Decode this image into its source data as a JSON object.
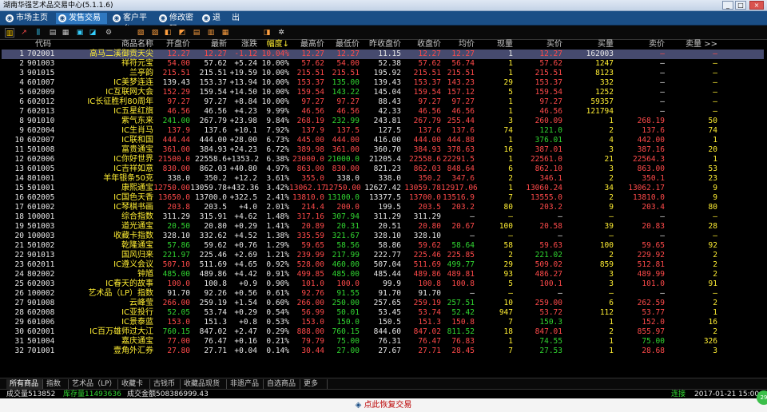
{
  "window": {
    "title": "湖南华强艺术品交易中心(5.1.1.6)",
    "min_label": "_",
    "max_label": "□",
    "close_label": "×"
  },
  "menu": [
    {
      "label": "市场主页",
      "active": false
    },
    {
      "label": "发售交易",
      "active": true
    },
    {
      "label": "客户平台",
      "active": false
    },
    {
      "label": "修改密码",
      "active": false
    },
    {
      "label": "退",
      "active": false
    },
    {
      "label": "出",
      "active": false
    }
  ],
  "toolbar_icons": [
    "bar-chart-icon",
    "line-chart-icon",
    "candle-icon",
    "list-icon",
    "calendar-icon",
    "grid-icon",
    "refresh-icon",
    "gear-icon",
    "book-icon",
    "sort-icon",
    "info-icon",
    "link-icon",
    "excel-icon",
    "print-icon",
    "cell-icon",
    "bell-icon",
    "settings-icon"
  ],
  "columns": [
    "代码",
    "商品名称",
    "开盘价",
    "最新",
    "涨跌",
    "幅度↓",
    "最高价",
    "最低价",
    "昨收盘价",
    "收盘价",
    "均价",
    "现量",
    "买价",
    "买量",
    "卖价",
    "卖量 >>"
  ],
  "rows": [
    [
      "1",
      "702001",
      "高马二溪御贡天尖",
      "12.27",
      "12.27",
      "-1.12",
      "10.04%",
      "12.27",
      "12.27",
      "11.15",
      "12.27",
      "12.27",
      "1",
      "12.27",
      "162003",
      "—",
      "—"
    ],
    [
      "2",
      "901003",
      "祥符元宝",
      "54.00",
      "57.62",
      "+5.24",
      "10.00%",
      "57.62",
      "54.00",
      "52.38",
      "57.62",
      "56.74",
      "1",
      "57.62",
      "1247",
      "—",
      "—"
    ],
    [
      "3",
      "901015",
      "兰亭韵",
      "215.51",
      "215.51",
      "+19.59",
      "10.00%",
      "215.51",
      "215.51",
      "195.92",
      "215.51",
      "215.51",
      "1",
      "215.51",
      "8123",
      "—",
      "—"
    ],
    [
      "4",
      "601007",
      "IC美梦连连",
      "139.43",
      "153.37",
      "+13.94",
      "10.00%",
      "153.37",
      "135.00",
      "139.43",
      "153.37",
      "143.23",
      "29",
      "153.37",
      "332",
      "—",
      "—"
    ],
    [
      "5",
      "602009",
      "IC互联网大会",
      "152.29",
      "159.54",
      "+14.50",
      "10.00%",
      "159.54",
      "143.22",
      "145.04",
      "159.54",
      "157.12",
      "5",
      "159.54",
      "1252",
      "—",
      "—"
    ],
    [
      "6",
      "602012",
      "IC长征胜利80周年",
      "97.27",
      "97.27",
      "+8.84",
      "10.00%",
      "97.27",
      "97.27",
      "88.43",
      "97.27",
      "97.27",
      "1",
      "97.27",
      "59357",
      "—",
      "—"
    ],
    [
      "7",
      "602013",
      "IC五星红旗",
      "46.56",
      "46.56",
      "+4.23",
      "9.99%",
      "46.56",
      "46.56",
      "42.33",
      "46.56",
      "46.56",
      "1",
      "46.56",
      "121794",
      "—",
      "—"
    ],
    [
      "8",
      "901010",
      "紫气东来",
      "241.00",
      "267.79",
      "+23.98",
      "9.84%",
      "268.19",
      "232.99",
      "243.81",
      "267.79",
      "255.44",
      "3",
      "260.09",
      "1",
      "268.19",
      "50"
    ],
    [
      "9",
      "602004",
      "IC生肖马",
      "137.9",
      "137.6",
      "+10.1",
      "7.92%",
      "137.9",
      "137.5",
      "127.5",
      "137.6",
      "137.6",
      "74",
      "121.0",
      "2",
      "137.6",
      "74"
    ],
    [
      "10",
      "602007",
      "IC联和国",
      "444.44",
      "444.00",
      "+28.00",
      "6.73%",
      "445.00",
      "444.00",
      "416.00",
      "444.00",
      "444.88",
      "1",
      "376.01",
      "4",
      "442.00",
      "1"
    ],
    [
      "11",
      "501008",
      "富贵通宝",
      "361.00",
      "384.93",
      "+24.23",
      "6.72%",
      "389.98",
      "361.00",
      "360.70",
      "384.93",
      "378.63",
      "16",
      "387.01",
      "3",
      "387.16",
      "20"
    ],
    [
      "12",
      "602006",
      "IC你好世界",
      "21500.0",
      "22558.6",
      "+1353.2",
      "6.38%",
      "23000.0",
      "21000.0",
      "21205.4",
      "22558.6",
      "22291.5",
      "1",
      "22561.0",
      "21",
      "22564.3",
      "1"
    ],
    [
      "13",
      "601005",
      "IC吉祥如意",
      "830.00",
      "862.03",
      "+40.80",
      "4.97%",
      "863.00",
      "830.00",
      "821.23",
      "862.03",
      "848.64",
      "6",
      "862.10",
      "3",
      "863.00",
      "53"
    ],
    [
      "14",
      "801001",
      "羊年银条50克",
      "338.0",
      "350.2",
      "+12.2",
      "3.61%",
      "355.0",
      "338.0",
      "338.0",
      "350.2",
      "347.6",
      "2",
      "346.1",
      "2",
      "350.1",
      "23"
    ],
    [
      "15",
      "501001",
      "康熙通宝",
      "12750.00",
      "13059.78",
      "+432.36",
      "3.42%",
      "13062.17",
      "12750.00",
      "12627.42",
      "13059.78",
      "12917.06",
      "1",
      "13060.24",
      "34",
      "13062.17",
      "9"
    ],
    [
      "16",
      "602005",
      "IC国色天香",
      "13650.0",
      "13700.0",
      "+322.5",
      "2.41%",
      "13810.0",
      "13100.0",
      "13377.5",
      "13700.0",
      "13516.9",
      "7",
      "13555.0",
      "2",
      "13810.0",
      "9"
    ],
    [
      "17",
      "601002",
      "IC琴棋书画",
      "203.8",
      "203.5",
      "+4.0",
      "2.01%",
      "214.4",
      "200.0",
      "199.5",
      "203.5",
      "203.2",
      "80",
      "203.2",
      "9",
      "203.4",
      "80"
    ],
    [
      "18",
      "100001",
      "综合指数",
      "311.29",
      "315.91",
      "+4.62",
      "1.48%",
      "317.16",
      "307.94",
      "311.29",
      "311.29",
      "—",
      "—",
      "—",
      "—",
      "—",
      "—"
    ],
    [
      "19",
      "501003",
      "道光通宝",
      "20.50",
      "20.80",
      "+0.29",
      "1.41%",
      "20.89",
      "20.31",
      "20.51",
      "20.80",
      "20.67",
      "100",
      "20.58",
      "39",
      "20.83",
      "28"
    ],
    [
      "20",
      "100003",
      "收藏卡指数",
      "328.10",
      "332.62",
      "+4.52",
      "1.38%",
      "335.59",
      "321.67",
      "328.10",
      "328.10",
      "—",
      "—",
      "—",
      "—",
      "—",
      "—"
    ],
    [
      "21",
      "501002",
      "乾隆通宝",
      "57.86",
      "59.62",
      "+0.76",
      "1.29%",
      "59.65",
      "58.56",
      "58.86",
      "59.62",
      "58.64",
      "58",
      "59.63",
      "100",
      "59.65",
      "92"
    ],
    [
      "22",
      "901013",
      "国风归来",
      "221.97",
      "225.46",
      "+2.69",
      "1.21%",
      "239.99",
      "217.99",
      "222.77",
      "225.46",
      "225.85",
      "2",
      "221.02",
      "2",
      "229.92",
      "2"
    ],
    [
      "23",
      "602011",
      "IC遵义会议",
      "507.10",
      "511.69",
      "+4.65",
      "0.92%",
      "528.00",
      "460.00",
      "507.04",
      "511.69",
      "499.77",
      "29",
      "509.02",
      "859",
      "512.81",
      "2"
    ],
    [
      "24",
      "802002",
      "钟馗",
      "485.00",
      "489.86",
      "+4.42",
      "0.91%",
      "499.85",
      "485.00",
      "485.44",
      "489.86",
      "489.81",
      "93",
      "486.27",
      "3",
      "489.99",
      "2"
    ],
    [
      "25",
      "602003",
      "IC春天的故事",
      "100.0",
      "100.8",
      "+0.9",
      "0.90%",
      "101.0",
      "100.0",
      "99.9",
      "100.8",
      "100.8",
      "5",
      "100.1",
      "3",
      "101.0",
      "91"
    ],
    [
      "26",
      "100002",
      "艺术品（LP）指数",
      "91.70",
      "92.26",
      "+0.56",
      "0.61%",
      "92.76",
      "91.55",
      "91.70",
      "91.70",
      "—",
      "—",
      "—",
      "—",
      "—",
      "—"
    ],
    [
      "27",
      "901008",
      "云峰莹",
      "266.00",
      "259.19",
      "+1.54",
      "0.60%",
      "266.00",
      "250.00",
      "257.65",
      "259.19",
      "257.51",
      "10",
      "259.00",
      "6",
      "262.59",
      "2"
    ],
    [
      "28",
      "602008",
      "IC亚投行",
      "52.05",
      "53.74",
      "+0.29",
      "0.54%",
      "56.99",
      "50.01",
      "53.45",
      "53.74",
      "52.42",
      "947",
      "53.72",
      "112",
      "53.77",
      "1"
    ],
    [
      "29",
      "601006",
      "IC景泰蓝",
      "153.0",
      "151.3",
      "+0.8",
      "0.53%",
      "153.0",
      "150.0",
      "150.5",
      "151.3",
      "150.8",
      "7",
      "150.3",
      "1",
      "152.0",
      "16"
    ],
    [
      "30",
      "602001",
      "IC百万雄师过大江",
      "760.15",
      "847.02",
      "+2.47",
      "0.29%",
      "888.00",
      "760.15",
      "844.60",
      "847.02",
      "811.52",
      "18",
      "847.01",
      "2",
      "855.97",
      "2"
    ],
    [
      "31",
      "501004",
      "嘉庆通宝",
      "77.00",
      "76.47",
      "+0.16",
      "0.21%",
      "79.79",
      "75.00",
      "76.31",
      "76.47",
      "76.83",
      "1",
      "74.55",
      "1",
      "75.00",
      "326"
    ],
    [
      "32",
      "701001",
      "壹角外汇券",
      "27.80",
      "27.71",
      "+0.04",
      "0.14%",
      "30.44",
      "27.00",
      "27.67",
      "27.71",
      "28.45",
      "7",
      "27.53",
      "1",
      "28.68",
      "3"
    ]
  ],
  "tabs": [
    "所有商品",
    "指数",
    "艺术品（LP）",
    "收藏卡",
    "古钱币",
    "收藏品现货",
    "非遗产品",
    "自选商品",
    "更多>>"
  ],
  "status": {
    "volume_label": "成交量513852",
    "stock_label": "库存量11493636",
    "amount_label": "成交金额508386999.43",
    "conn_label": "连接",
    "datetime": "2017-01-21 15:00"
  },
  "bottom_bar": {
    "label": "点此恢复交易"
  },
  "colors": {
    "up": "#ff4a4a",
    "down": "#31d631",
    "flat": "#e6e6e6",
    "menu_bg": "#1a4e86"
  }
}
